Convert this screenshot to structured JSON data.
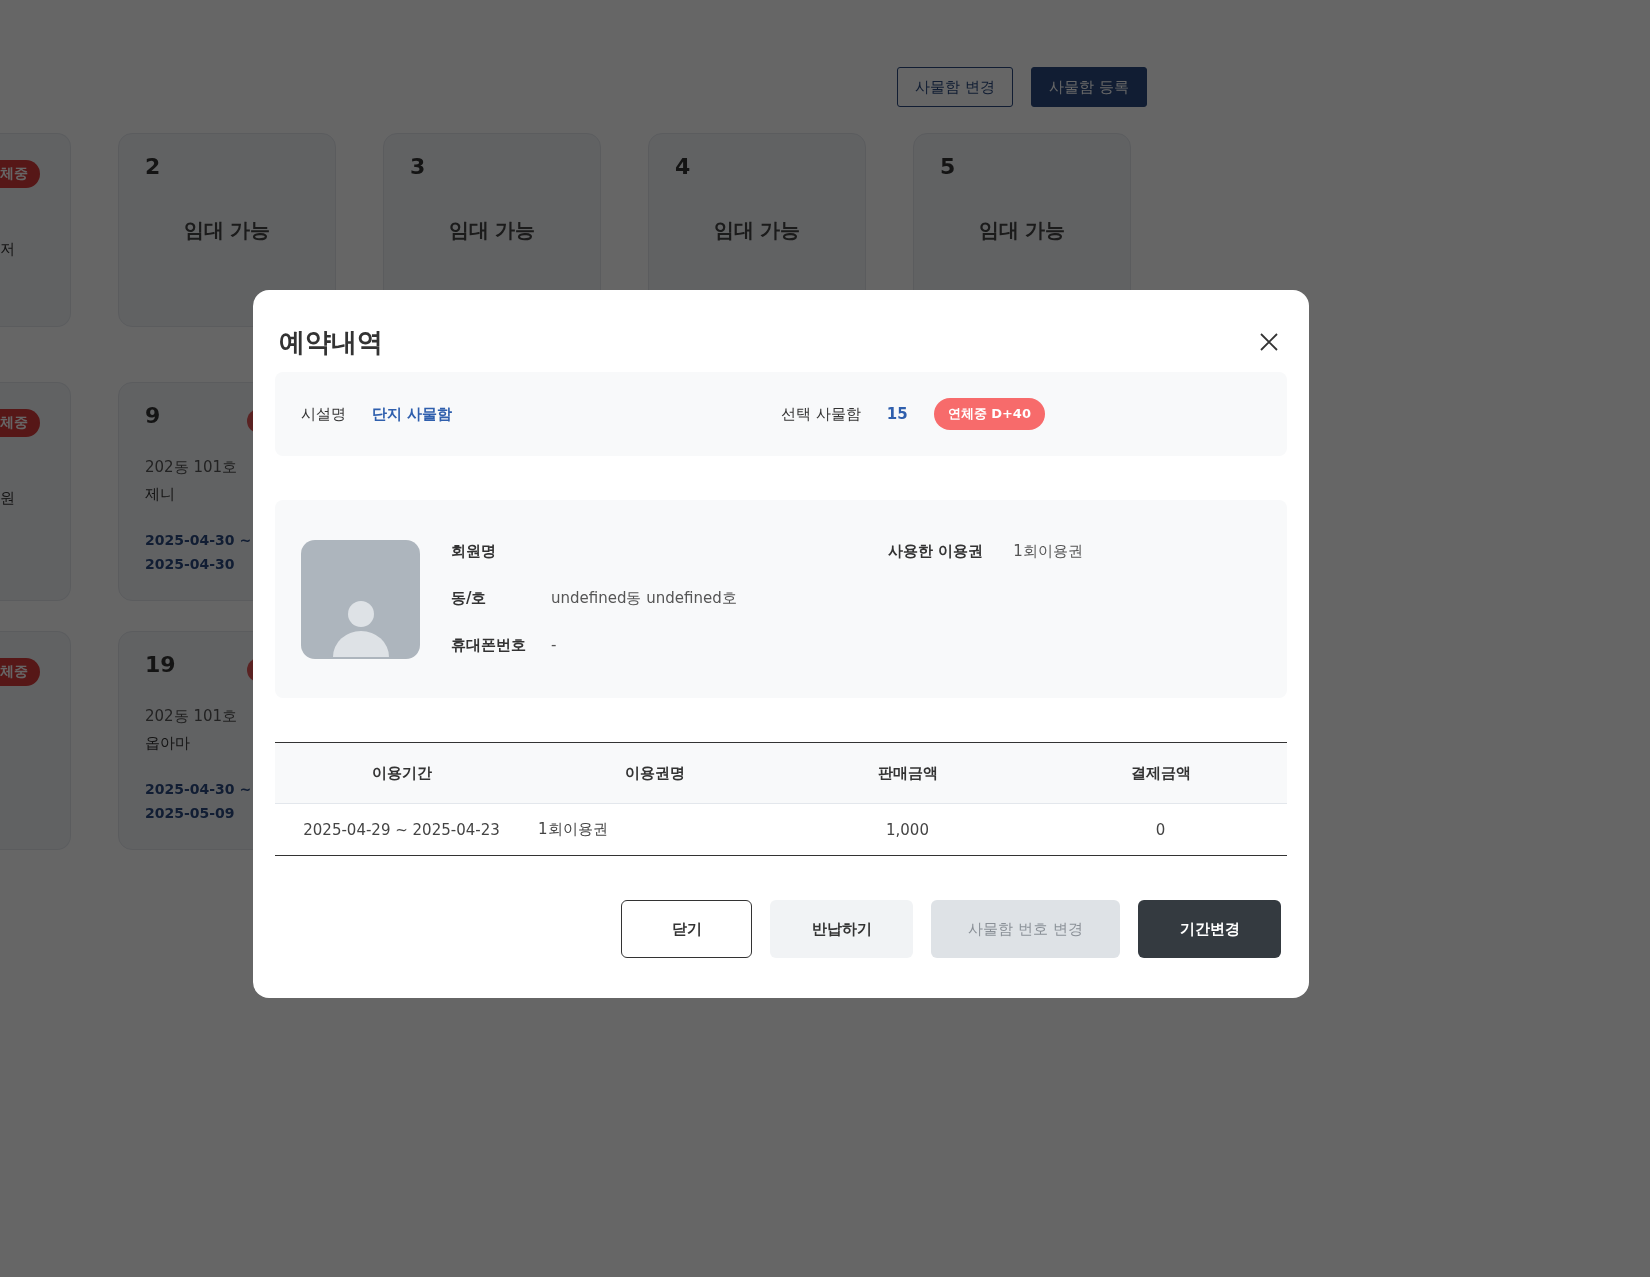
{
  "toolbar": {
    "buttons": [
      {
        "label": "사물함 변경",
        "kind": "outline"
      },
      {
        "label": "사물함 등록",
        "kind": "filled"
      }
    ]
  },
  "locker_rows": [
    {
      "edge_card": {
        "badge": "체중",
        "text": "저"
      },
      "cards": [
        {
          "number": "2",
          "status": "임대 가능"
        },
        {
          "number": "3",
          "status": "임대 가능"
        },
        {
          "number": "4",
          "status": "임대 가능"
        },
        {
          "number": "5",
          "status": "임대 가능"
        }
      ]
    },
    {
      "edge_card": {
        "badge": "체중",
        "text": "원"
      },
      "cards": [
        {
          "number": "9",
          "overdue": true,
          "unit": "202동 101호",
          "member": "제니",
          "period": [
            "2025-04-30 ~",
            "2025-04-30"
          ]
        }
      ]
    },
    {
      "edge_card": {
        "badge": "체중"
      },
      "cards": [
        {
          "number": "19",
          "overdue": true,
          "unit": "202동 101호",
          "member": "옵아마",
          "period": [
            "2025-04-30 ~",
            "2025-05-09"
          ]
        }
      ]
    }
  ],
  "modal": {
    "title": "예약내역",
    "facility": {
      "label": "시설명",
      "value": "단지 사물함"
    },
    "locker": {
      "label": "선택 사물함",
      "value": "15",
      "badge": "연체중 D+40"
    },
    "member_fields": [
      {
        "label": "회원명"
      },
      {
        "label": "동/호",
        "value": "undefined동 undefined호"
      },
      {
        "label": "휴대폰번호",
        "value": "-"
      }
    ],
    "pass_field": {
      "label": "사용한 이용권",
      "value": "1회이용권"
    },
    "table": {
      "columns": [
        "이용기간",
        "이용권명",
        "판매금액",
        "결제금액"
      ],
      "rows": [
        [
          "2025-04-29 ~ 2025-04-23",
          "1회이용권",
          "1,000",
          "0"
        ]
      ]
    },
    "buttons": [
      {
        "label": "닫기",
        "kind": "outline",
        "disabled": false
      },
      {
        "label": "반납하기",
        "kind": "light",
        "disabled": false
      },
      {
        "label": "사물함 번호 변경",
        "kind": "light",
        "disabled": true
      },
      {
        "label": "기간변경",
        "kind": "dark",
        "disabled": false
      }
    ]
  }
}
